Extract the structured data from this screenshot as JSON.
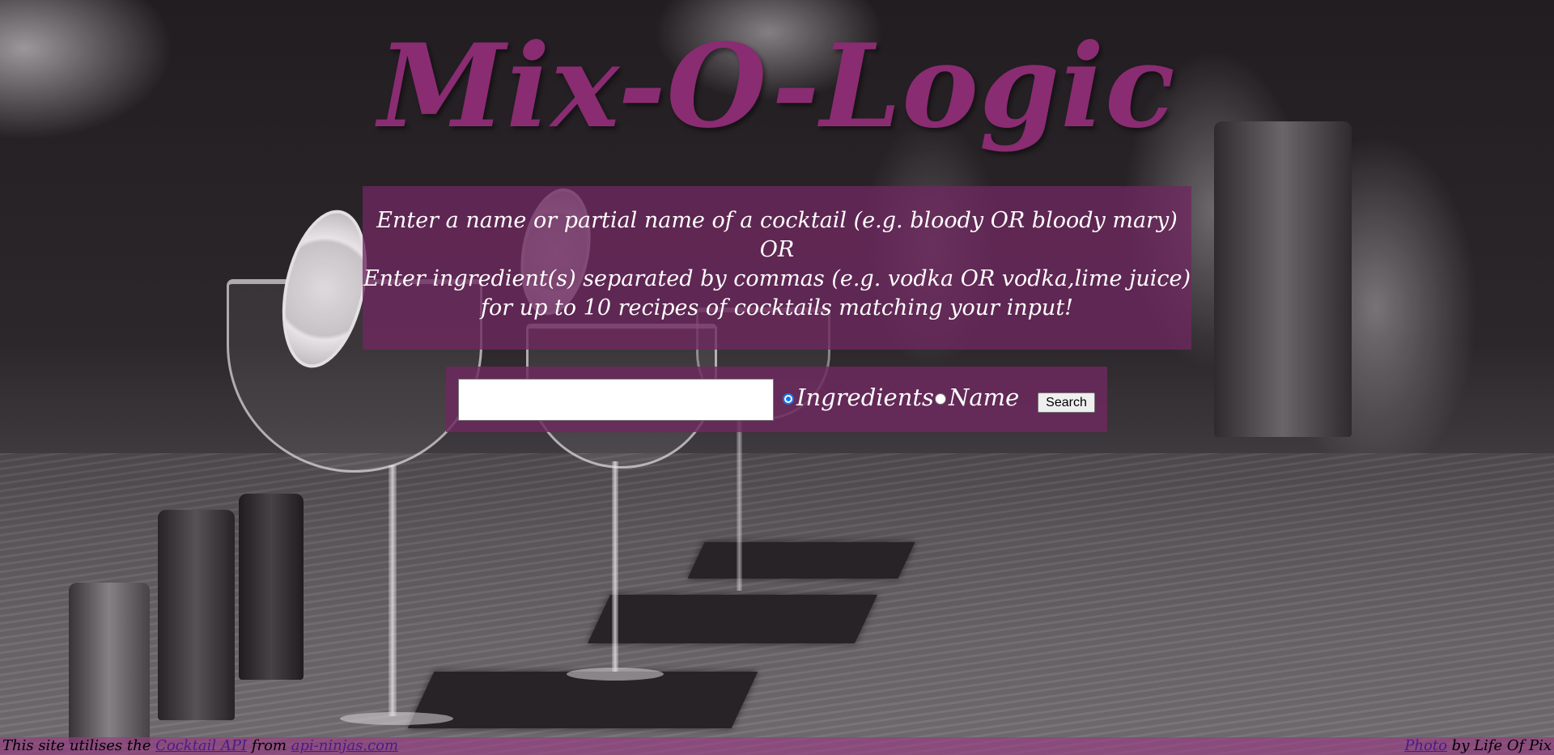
{
  "app": {
    "title": "Mix-O-Logic"
  },
  "instructions": {
    "line1": "Enter a name or partial name of a cocktail (e.g. bloody OR bloody mary)",
    "line2": "OR",
    "line3": "Enter ingredient(s) separated by commas (e.g. vodka OR vodka,lime juice)",
    "line4": "for up to 10 recipes of cocktails matching your input!"
  },
  "search": {
    "input_value": "",
    "placeholder": "",
    "options": [
      {
        "label": "Ingredients",
        "checked": true
      },
      {
        "label": "Name",
        "checked": false
      }
    ],
    "button_label": "Search"
  },
  "footer": {
    "left_prefix": "This site utilises the ",
    "api_link": "Cocktail API",
    "from_text": " from ",
    "provider_link": "api-ninjas.com",
    "photo_link": "Photo",
    "photo_credit": " by Life Of Pix"
  },
  "colors": {
    "title": "#8a2c72",
    "panel": "#6e285f",
    "footer_bar": "#963c82",
    "link": "#4b1a8c",
    "radio_checked": "#1a73e8"
  },
  "icons": {
    "radio_checked": "radio-checked-icon",
    "radio_unchecked": "radio-unchecked-icon"
  }
}
